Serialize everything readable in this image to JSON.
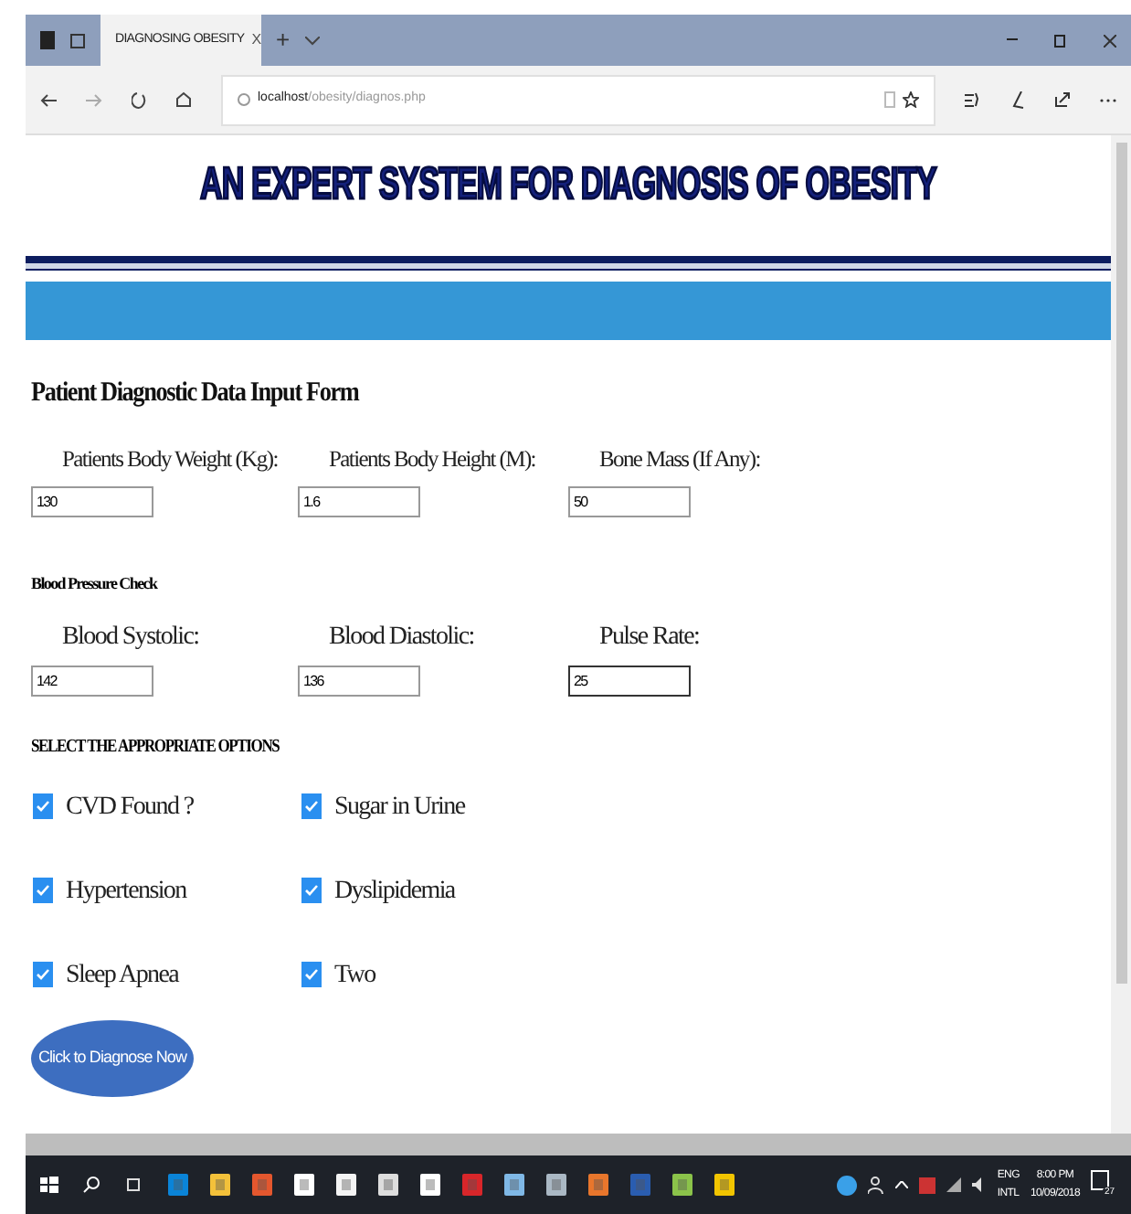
{
  "browser": {
    "tab_title": "DIAGNOSING OBESITY",
    "tab_close": "X",
    "new_tab": "+",
    "url_host": "localhost",
    "url_path": "/obesity/diagnos.php"
  },
  "page": {
    "banner_title": "AN EXPERT SYSTEM FOR DIAGNOSIS OF OBESITY",
    "form_title": "Patient Diagnostic Data Input Form",
    "measurements": [
      {
        "label": "Patients Body Weight (Kg):",
        "value": "130"
      },
      {
        "label": "Patients Body Height (M):",
        "value": "1.6"
      },
      {
        "label": "Bone Mass (If Any):",
        "value": "50"
      }
    ],
    "bp_heading": "Blood Pressure Check",
    "blood_pressure": [
      {
        "label": "Blood Systolic:",
        "value": "142"
      },
      {
        "label": "Blood Diastolic:",
        "value": "136"
      },
      {
        "label": "Pulse Rate:",
        "value": "25"
      }
    ],
    "options_heading": "SELECT THE APPROPRIATE OPTIONS",
    "options": [
      {
        "label": "CVD Found ?",
        "checked": true
      },
      {
        "label": "Sugar in Urine",
        "checked": true
      },
      {
        "label": "Hypertension",
        "checked": true
      },
      {
        "label": "Dyslipidemia",
        "checked": true
      },
      {
        "label": "Sleep Apnea",
        "checked": true
      },
      {
        "label": "Two",
        "checked": true
      }
    ],
    "submit": "Click to Diagnose Now"
  },
  "taskbar": {
    "language": "ENG",
    "layout": "INTL",
    "time": "8:00 PM",
    "date": "10/09/2018",
    "notifications": "27"
  }
}
